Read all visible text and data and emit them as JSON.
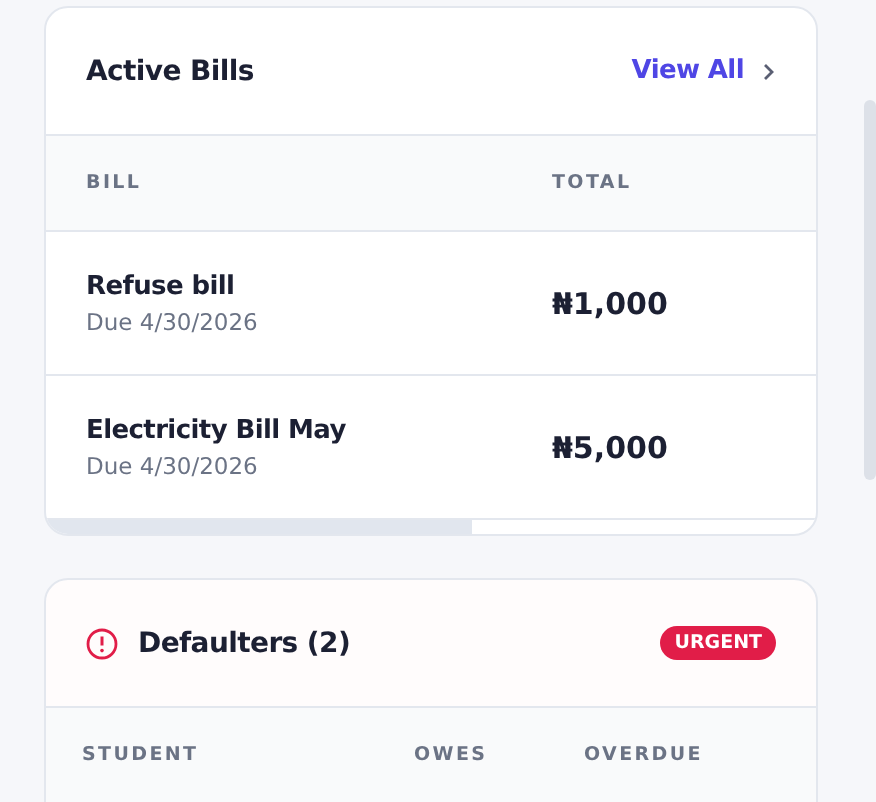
{
  "bills_card": {
    "title": "Active Bills",
    "view_all": "View All",
    "columns": [
      "BILL",
      "TOTAL"
    ],
    "rows": [
      {
        "name": "Refuse bill",
        "due": "Due 4/30/2026",
        "total": "₦1,000"
      },
      {
        "name": "Electricity Bill May",
        "due": "Due 4/30/2026",
        "total": "₦5,000"
      }
    ]
  },
  "defaulters_card": {
    "title": "Defaulters (2)",
    "badge": "URGENT",
    "columns": [
      "STUDENT",
      "OWES",
      "OVERDUE"
    ]
  }
}
